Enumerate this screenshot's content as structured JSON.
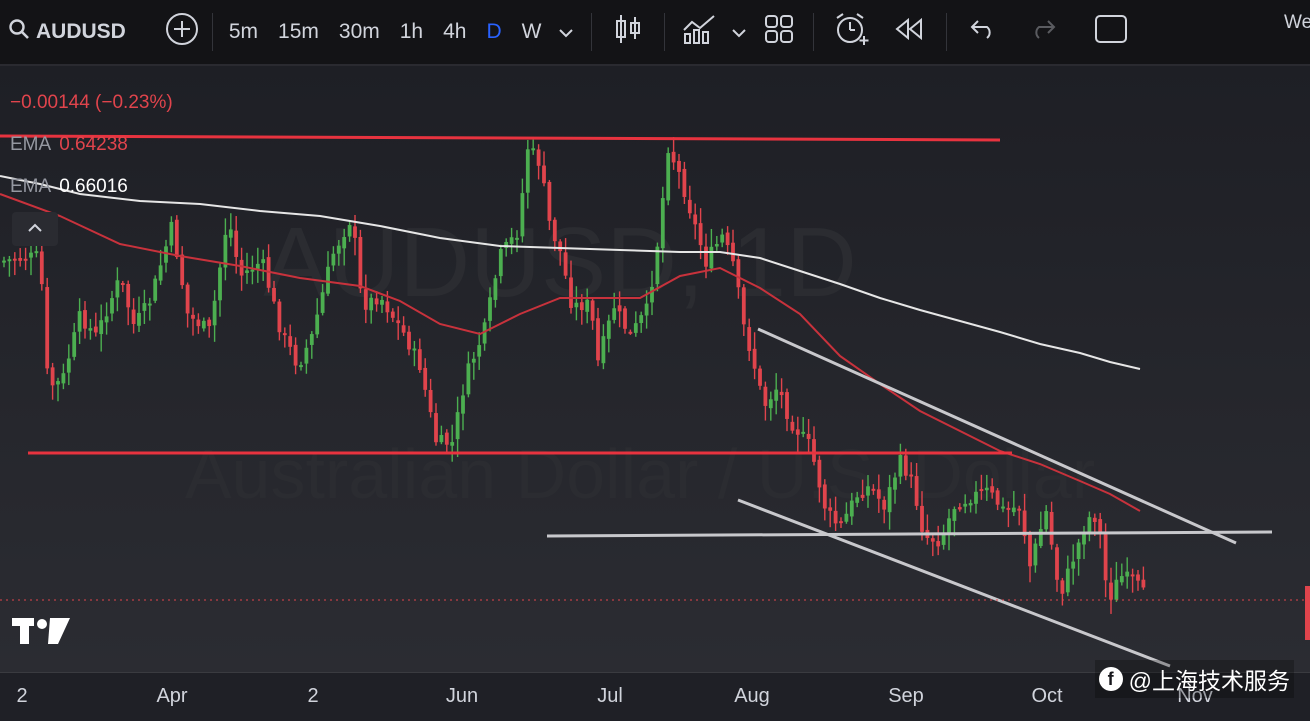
{
  "toolbar": {
    "symbol": "AUDUSD",
    "timeframes": [
      "5m",
      "15m",
      "30m",
      "1h",
      "4h",
      "D",
      "W"
    ],
    "active_timeframe": "D",
    "right_edge_text": "We"
  },
  "legend": {
    "change": "−0.00144 (−0.23%)",
    "ema_label": "EMA",
    "ema_fast_value": "0.64238",
    "ema_slow_value": "0.66016"
  },
  "watermark": {
    "symbol_text": "AUDUSD, 1D",
    "description": "Australian Dollar / U.S. Dollar",
    "handle": "@上海技术服务"
  },
  "x_axis": {
    "labels": [
      "2",
      "Apr",
      "2",
      "Jun",
      "Jul",
      "Aug",
      "Sep",
      "Oct",
      "Nov"
    ]
  },
  "colors": {
    "up": "#4caf50",
    "down": "#e0444c",
    "ema_fast": "#c8323c",
    "ema_slow": "#e6e6e6",
    "level_red": "#e8333f",
    "trend_white": "#c8c8cc",
    "accent": "#2962ff"
  },
  "icons": {
    "symbol_search": "search-icon",
    "add": "plus-circle-icon",
    "candles": "candlestick-icon",
    "indicators": "indicators-icon",
    "layout": "grid-icon",
    "alert": "alarm-clock-icon",
    "replay": "rewind-icon",
    "undo": "undo-icon",
    "redo": "redo-icon",
    "fullscreen": "square-icon"
  }
}
